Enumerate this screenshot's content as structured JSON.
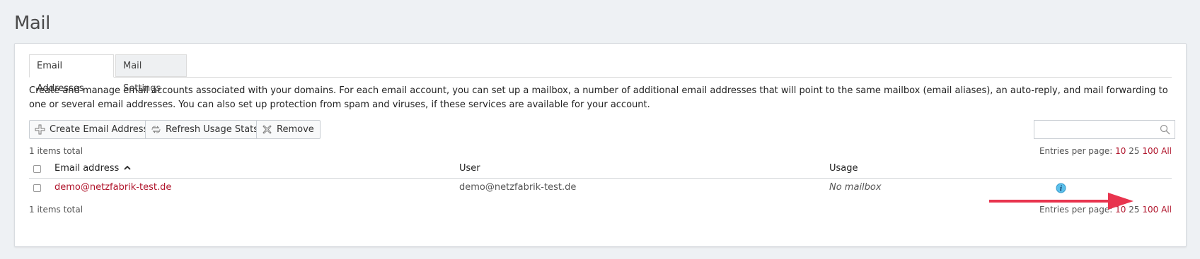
{
  "page": {
    "title": "Mail"
  },
  "tabs": [
    {
      "label": "Email Addresses",
      "active": true
    },
    {
      "label": "Mail Settings",
      "active": false
    }
  ],
  "description": "Create and manage email accounts associated with your domains. For each email account, you can set up a mailbox, a number of additional email addresses that will point to the same mailbox (email aliases), an auto-reply, and mail forwarding to one or several email addresses. You can also set up protection from spam and viruses, if these services are available for your account.",
  "toolbar": {
    "create_label": "Create Email Address",
    "refresh_label": "Refresh Usage Stats",
    "remove_label": "Remove",
    "search_placeholder": ""
  },
  "list": {
    "total_top": "1 items total",
    "total_bottom": "1 items total",
    "entries_label": "Entries per page:",
    "page_sizes": [
      "10",
      "25",
      "100",
      "All"
    ],
    "current_page_size": "25",
    "columns": {
      "email": "Email address",
      "user": "User",
      "usage": "Usage"
    },
    "sort_indicator": "^",
    "rows": [
      {
        "email": "demo@netzfabrik-test.de",
        "user": "demo@netzfabrik-test.de",
        "usage": "No mailbox"
      }
    ]
  },
  "colors": {
    "link": "#b0142b",
    "info_icon": "#5bc0eb",
    "arrow": "#e8344e"
  },
  "icons": [
    "plus-icon",
    "refresh-icon",
    "remove-icon",
    "search-icon",
    "info-icon",
    "sort-ascending-icon",
    "arrow-annotation"
  ]
}
